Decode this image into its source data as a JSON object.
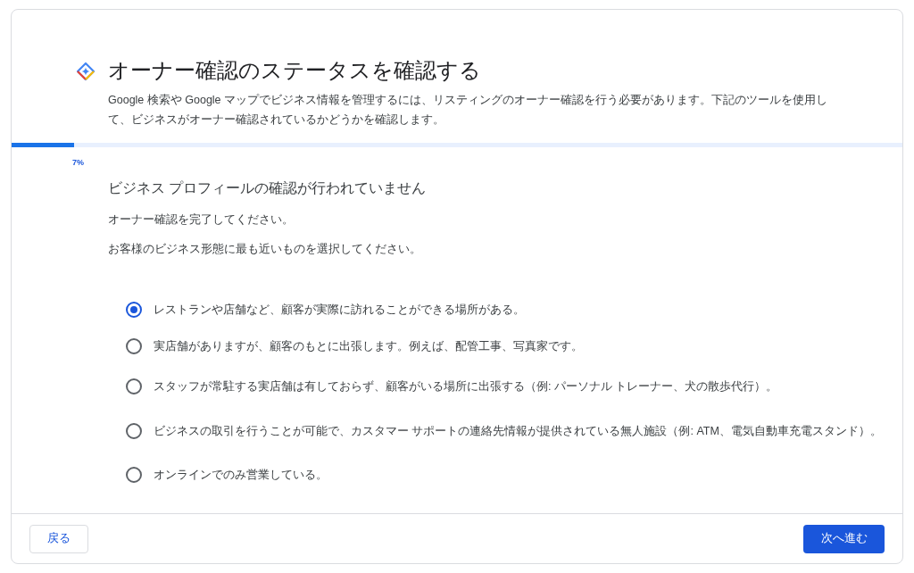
{
  "header": {
    "title": "オーナー確認のステータスを確認する",
    "description": "Google 検索や Google マップでビジネス情報を管理するには、リスティングのオーナー確認を行う必要があります。下記のツールを使用して、ビジネスがオーナー確認されているかどうかを確認します。"
  },
  "progress": {
    "level": 0.07,
    "reading": "7%"
  },
  "section": {
    "heading": "ビジネス プロフィールの確認が行われていません",
    "paragraphs": [
      "オーナー確認を完了してください。",
      "お客様のビジネス形態に最も近いものを選択してください。"
    ]
  },
  "options": [
    {
      "label": "レストランや店舗など、顧客が実際に訪れることができる場所がある。",
      "selected": true
    },
    {
      "label": "実店舗がありますが、顧客のもとに出張します。例えば、配管工事、写真家です。",
      "selected": false
    },
    {
      "label": "スタッフが常駐する実店舗は有しておらず、顧客がいる場所に出張する（例: パーソナル トレーナー、犬の散歩代行）。",
      "selected": false
    },
    {
      "label": "ビジネスの取引を行うことが可能で、カスタマー サポートの連絡先情報が提供されている無人施設（例: ATM、電気自動車充電スタンド）。",
      "selected": false
    },
    {
      "label": "オンラインでのみ営業している。",
      "selected": false
    }
  ],
  "footer": {
    "back": "戻る",
    "next": "次へ進む"
  }
}
